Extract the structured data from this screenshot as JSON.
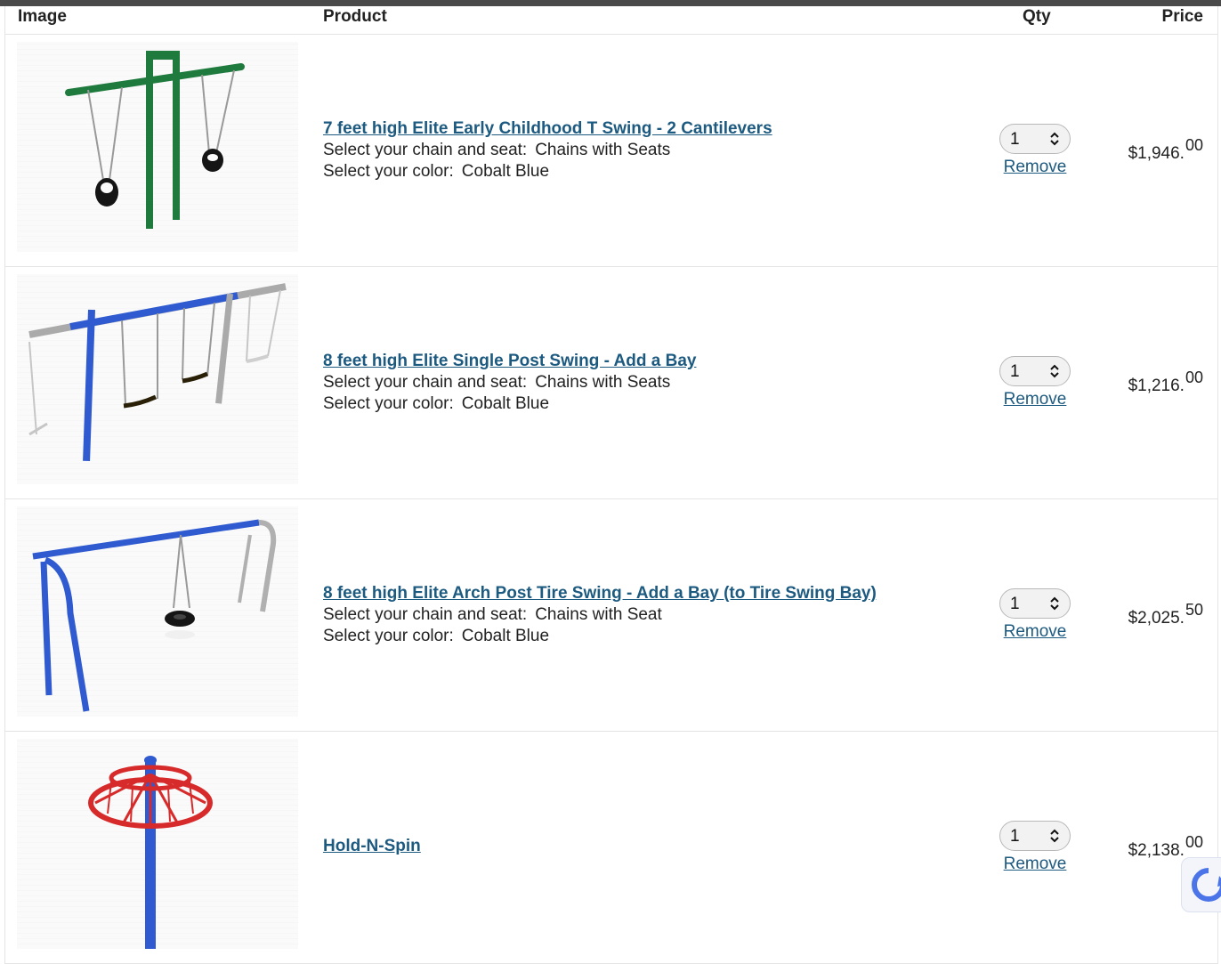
{
  "header": {
    "image": "Image",
    "product": "Product",
    "qty": "Qty",
    "price": "Price"
  },
  "items": [
    {
      "title": "7 feet high Elite Early Childhood T Swing - 2 Cantilevers",
      "options": [
        {
          "label": "Select your chain and seat:",
          "value": "Chains with Seats"
        },
        {
          "label": "Select your color:",
          "value": "Cobalt Blue"
        }
      ],
      "qty": "1",
      "remove": "Remove",
      "price_main": "$1,946.",
      "price_cents": "00"
    },
    {
      "title": "8 feet high Elite Single Post Swing - Add a Bay",
      "options": [
        {
          "label": "Select your chain and seat:",
          "value": "Chains with Seats"
        },
        {
          "label": "Select your color:",
          "value": "Cobalt Blue"
        }
      ],
      "qty": "1",
      "remove": "Remove",
      "price_main": "$1,216.",
      "price_cents": "00"
    },
    {
      "title": "8 feet high Elite Arch Post Tire Swing - Add a Bay (to Tire Swing Bay)",
      "options": [
        {
          "label": "Select your chain and seat:",
          "value": "Chains with Seat"
        },
        {
          "label": "Select your color:",
          "value": "Cobalt Blue"
        }
      ],
      "qty": "1",
      "remove": "Remove",
      "price_main": "$2,025.",
      "price_cents": "50"
    },
    {
      "title": "Hold-N-Spin",
      "options": [],
      "qty": "1",
      "remove": "Remove",
      "price_main": "$2,138.",
      "price_cents": "00"
    }
  ]
}
